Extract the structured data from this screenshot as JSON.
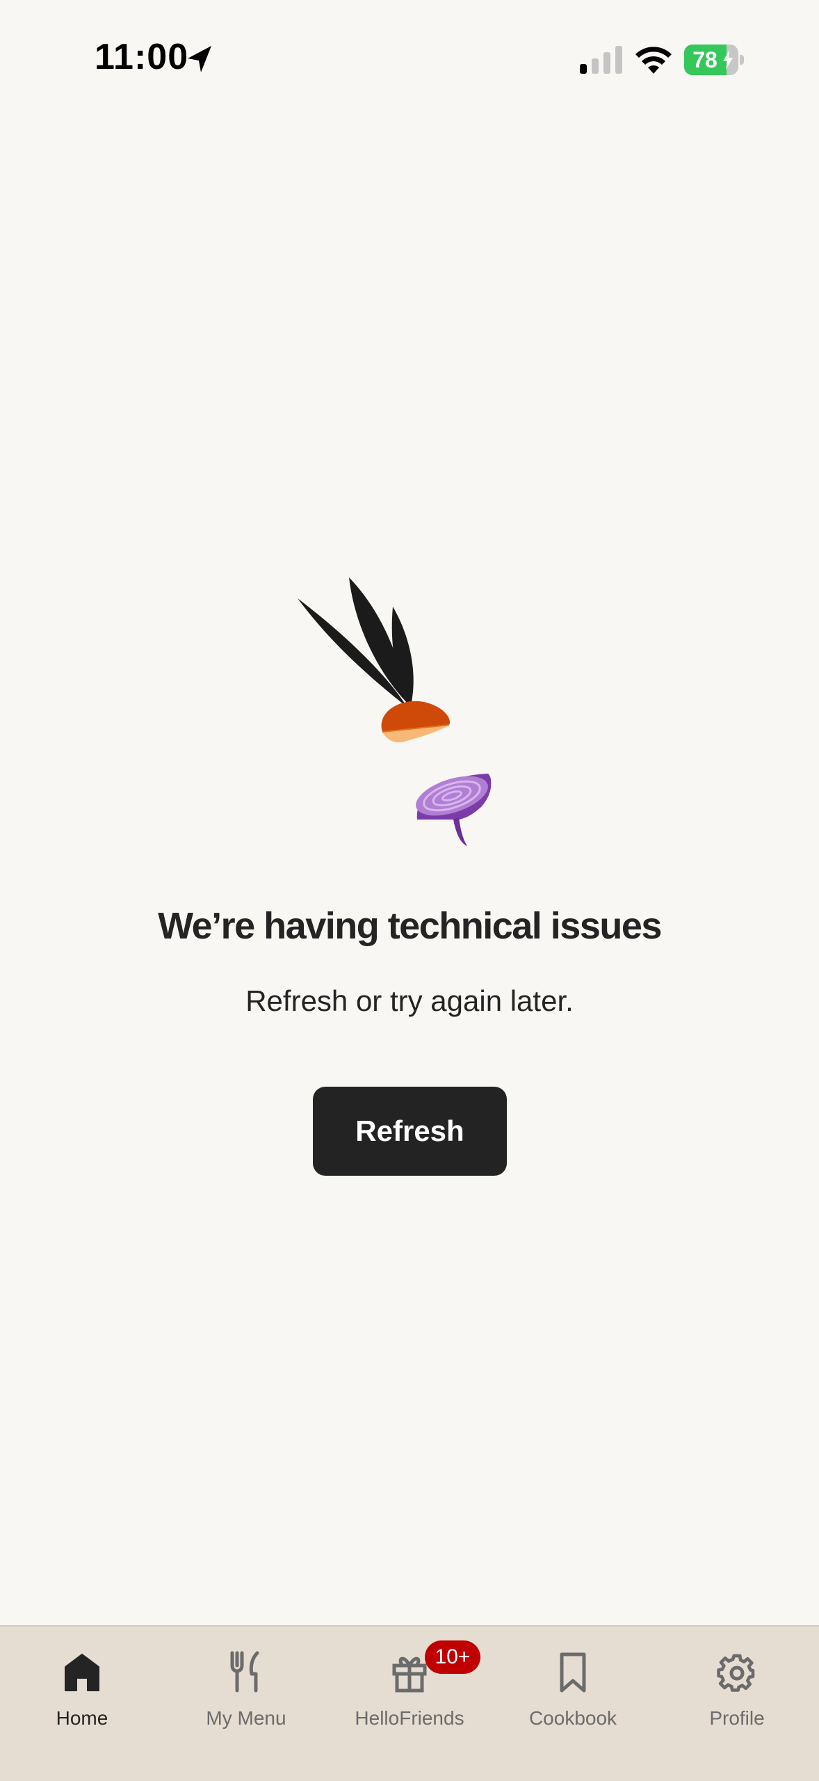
{
  "status_bar": {
    "time": "11:00",
    "battery_percent": "78",
    "battery_level": 0.78,
    "icons": [
      "location-arrow-icon",
      "cellular-signal-icon",
      "wifi-icon",
      "battery-charging-icon"
    ]
  },
  "error": {
    "title": "We’re having technical issues",
    "subtitle": "Refresh or try again later.",
    "refresh_label": "Refresh",
    "illustration": "sliced-radish-and-onion-illustration"
  },
  "tab_bar": {
    "items": [
      {
        "label": "Home",
        "icon": "home-icon",
        "active": true
      },
      {
        "label": "My Menu",
        "icon": "fork-knife-icon",
        "active": false
      },
      {
        "label": "HelloFriends",
        "icon": "gift-icon",
        "active": false,
        "badge": "10+"
      },
      {
        "label": "Cookbook",
        "icon": "bookmark-icon",
        "active": false
      },
      {
        "label": "Profile",
        "icon": "gear-icon",
        "active": false
      }
    ]
  },
  "colors": {
    "background": "#f9f7f3",
    "tab_bar_background": "#e5ddd1",
    "button_background": "#232323",
    "badge": "#c00000",
    "battery_green": "#34c759"
  }
}
